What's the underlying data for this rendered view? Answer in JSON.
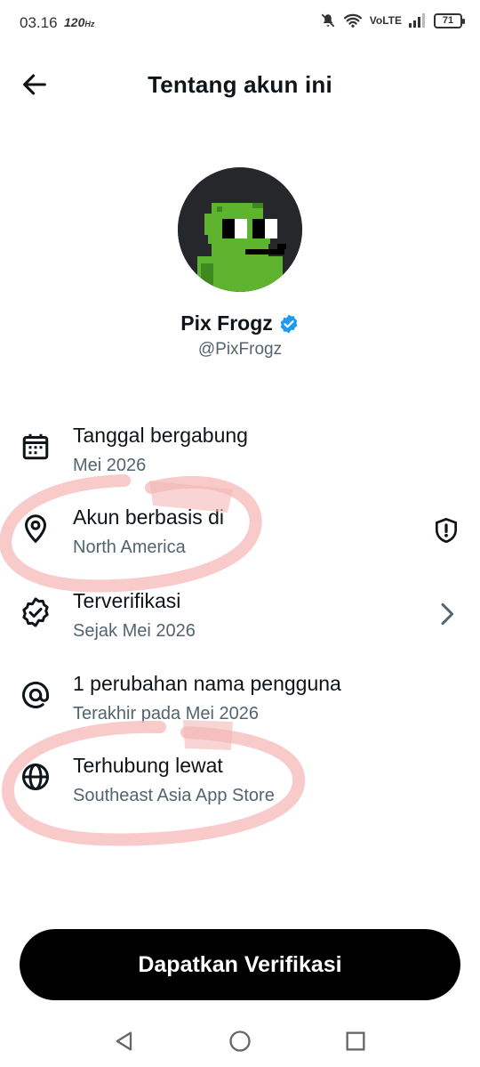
{
  "status_bar": {
    "time": "03.16",
    "refresh_rate": "120",
    "network": "VoLTE",
    "battery": "71",
    "icons": [
      "mute-bell-icon",
      "wifi-icon",
      "signal-icon",
      "battery-icon"
    ]
  },
  "header": {
    "title": "Tentang akun ini"
  },
  "profile": {
    "name": "Pix Frogz",
    "handle": "@PixFrogz",
    "verified_color": "#1d9bf0"
  },
  "info_items": [
    {
      "icon": "calendar-icon",
      "label": "Tanggal bergabung",
      "value": "Mei 2026"
    },
    {
      "icon": "location-pin-icon",
      "label": "Akun berbasis di",
      "value": "North America",
      "trailing_icon": "shield-alert-icon"
    },
    {
      "icon": "verified-badge-icon",
      "label": "Terverifikasi",
      "value": "Sejak Mei 2026",
      "trailing_icon": "chevron-right-icon"
    },
    {
      "icon": "at-sign-icon",
      "label": "1 perubahan nama pengguna",
      "value": "Terakhir pada Mei 2026"
    },
    {
      "icon": "globe-icon",
      "label": "Terhubung lewat",
      "value": "Southeast Asia App Store"
    }
  ],
  "cta": {
    "label": "Dapatkan Verifikasi"
  },
  "colors": {
    "text_primary": "#0f1419",
    "text_secondary": "#536471",
    "highlight_scribble": "#f5b8b8",
    "cta_background": "#000000"
  }
}
